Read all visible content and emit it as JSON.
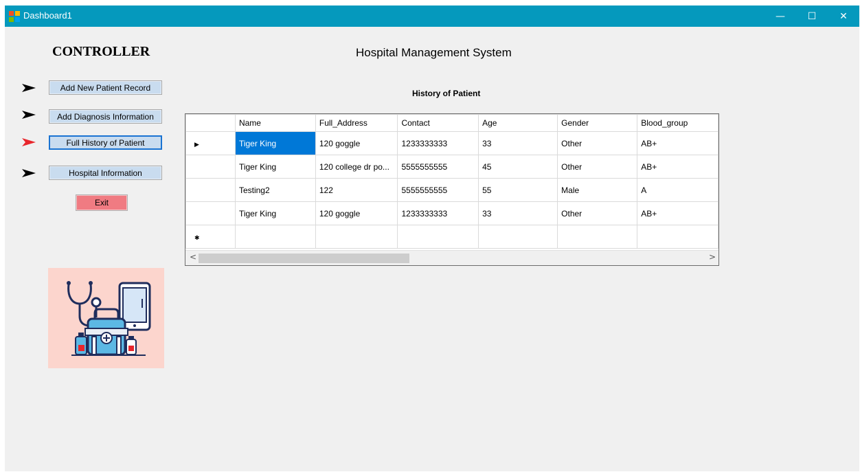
{
  "window": {
    "title": "Dashboard1",
    "minimize_glyph": "—",
    "maximize_glyph": "☐",
    "close_glyph": "✕",
    "titlebar_color": "#0599bd"
  },
  "sidebar": {
    "heading": "CONTROLLER",
    "buttons": [
      {
        "label": "Add New Patient Record",
        "arrow_color": "#000000"
      },
      {
        "label": "Add Diagnosis Information",
        "arrow_color": "#000000"
      },
      {
        "label": "Full History of Patient",
        "arrow_color": "#e8262c",
        "active": true
      },
      {
        "label": "Hospital Information",
        "arrow_color": "#000000"
      }
    ],
    "exit_label": "Exit",
    "exit_color": "#f07b82",
    "illustration_icon": "medical-kit-stethoscope-icon"
  },
  "main": {
    "title": "Hospital Management System",
    "section_title": "History of Patient",
    "grid": {
      "columns": [
        "Name",
        "Full_Address",
        "Contact",
        "Age",
        "Gender",
        "Blood_group"
      ],
      "rows": [
        [
          "Tiger King",
          "120 goggle",
          "1233333333",
          "33",
          "Other",
          "AB+"
        ],
        [
          "Tiger King",
          "120 college dr po...",
          "5555555555",
          "45",
          "Other",
          "AB+"
        ],
        [
          "Testing2",
          "122",
          "5555555555",
          "55",
          "Male",
          "A"
        ],
        [
          "Tiger King",
          "120 goggle",
          "1233333333",
          "33",
          "Other",
          "AB+"
        ]
      ],
      "current_row_marker": "▶",
      "new_row_marker": "✱",
      "scroll_left": "<",
      "scroll_right": ">",
      "selection_color": "#0078d7"
    }
  }
}
